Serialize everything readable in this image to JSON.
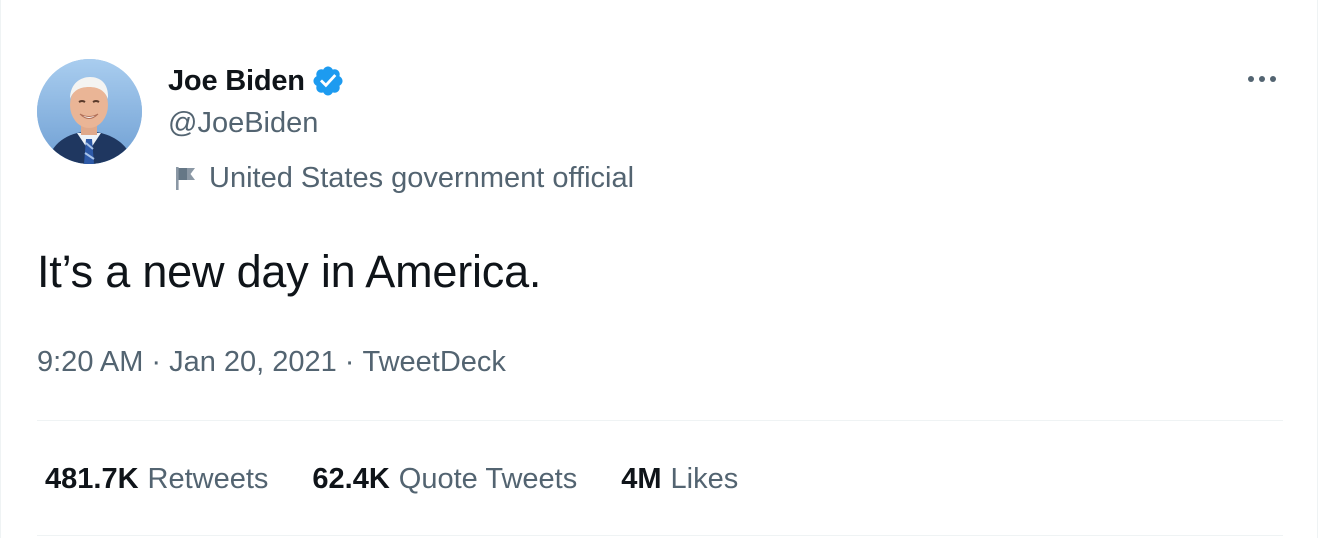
{
  "author": {
    "display_name": "Joe Biden",
    "handle": "@JoeBiden",
    "verified": true,
    "label": "United States government official",
    "label_icon": "flag-icon"
  },
  "tweet": {
    "text": "It’s a new day in America.",
    "time": "9:20 AM",
    "date": "Jan 20, 2021",
    "source": "TweetDeck",
    "separator": "·"
  },
  "stats": [
    {
      "value": "481.7K",
      "label": "Retweets"
    },
    {
      "value": "62.4K",
      "label": "Quote Tweets"
    },
    {
      "value": "4M",
      "label": "Likes"
    }
  ],
  "colors": {
    "text_primary": "#0f1419",
    "text_secondary": "#536471",
    "verified_blue": "#1d9bf0",
    "divider": "#eff3f4"
  },
  "icons": {
    "more": "more-horizontal-icon",
    "verified": "verified-badge-icon",
    "label": "flag-icon"
  }
}
